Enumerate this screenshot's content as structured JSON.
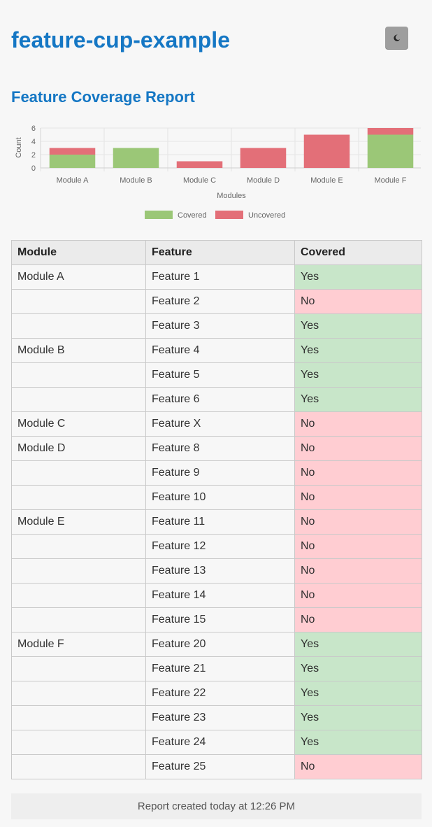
{
  "app": {
    "title": "feature-cup-example"
  },
  "theme_toggle": {
    "icon": "moon-icon"
  },
  "report": {
    "title": "Feature Coverage Report"
  },
  "chart_data": {
    "type": "bar",
    "stacked": true,
    "categories": [
      "Module A",
      "Module B",
      "Module C",
      "Module D",
      "Module E",
      "Module F"
    ],
    "series": [
      {
        "name": "Covered",
        "values": [
          2,
          3,
          0,
          0,
          0,
          5
        ],
        "color": "#9bc777"
      },
      {
        "name": "Uncovered",
        "values": [
          1,
          0,
          1,
          3,
          5,
          1
        ],
        "color": "#e36f78"
      }
    ],
    "title": "",
    "xlabel": "Modules",
    "ylabel": "Count",
    "ylim": [
      0,
      6
    ],
    "yticks": [
      0,
      2,
      4,
      6
    ],
    "grid": true,
    "legend_position": "bottom"
  },
  "table": {
    "headers": {
      "module": "Module",
      "feature": "Feature",
      "covered": "Covered"
    },
    "rows": [
      {
        "module": "Module A",
        "feature": "Feature 1",
        "covered": "Yes"
      },
      {
        "module": "",
        "feature": "Feature 2",
        "covered": "No"
      },
      {
        "module": "",
        "feature": "Feature 3",
        "covered": "Yes"
      },
      {
        "module": "Module B",
        "feature": "Feature 4",
        "covered": "Yes"
      },
      {
        "module": "",
        "feature": "Feature 5",
        "covered": "Yes"
      },
      {
        "module": "",
        "feature": "Feature 6",
        "covered": "Yes"
      },
      {
        "module": "Module C",
        "feature": "Feature X",
        "covered": "No"
      },
      {
        "module": "Module D",
        "feature": "Feature 8",
        "covered": "No"
      },
      {
        "module": "",
        "feature": "Feature 9",
        "covered": "No"
      },
      {
        "module": "",
        "feature": "Feature 10",
        "covered": "No"
      },
      {
        "module": "Module E",
        "feature": "Feature 11",
        "covered": "No"
      },
      {
        "module": "",
        "feature": "Feature 12",
        "covered": "No"
      },
      {
        "module": "",
        "feature": "Feature 13",
        "covered": "No"
      },
      {
        "module": "",
        "feature": "Feature 14",
        "covered": "No"
      },
      {
        "module": "",
        "feature": "Feature 15",
        "covered": "No"
      },
      {
        "module": "Module F",
        "feature": "Feature 20",
        "covered": "Yes"
      },
      {
        "module": "",
        "feature": "Feature 21",
        "covered": "Yes"
      },
      {
        "module": "",
        "feature": "Feature 22",
        "covered": "Yes"
      },
      {
        "module": "",
        "feature": "Feature 23",
        "covered": "Yes"
      },
      {
        "module": "",
        "feature": "Feature 24",
        "covered": "Yes"
      },
      {
        "module": "",
        "feature": "Feature 25",
        "covered": "No"
      }
    ]
  },
  "footer": {
    "text": "Report created today at 12:26 PM"
  }
}
